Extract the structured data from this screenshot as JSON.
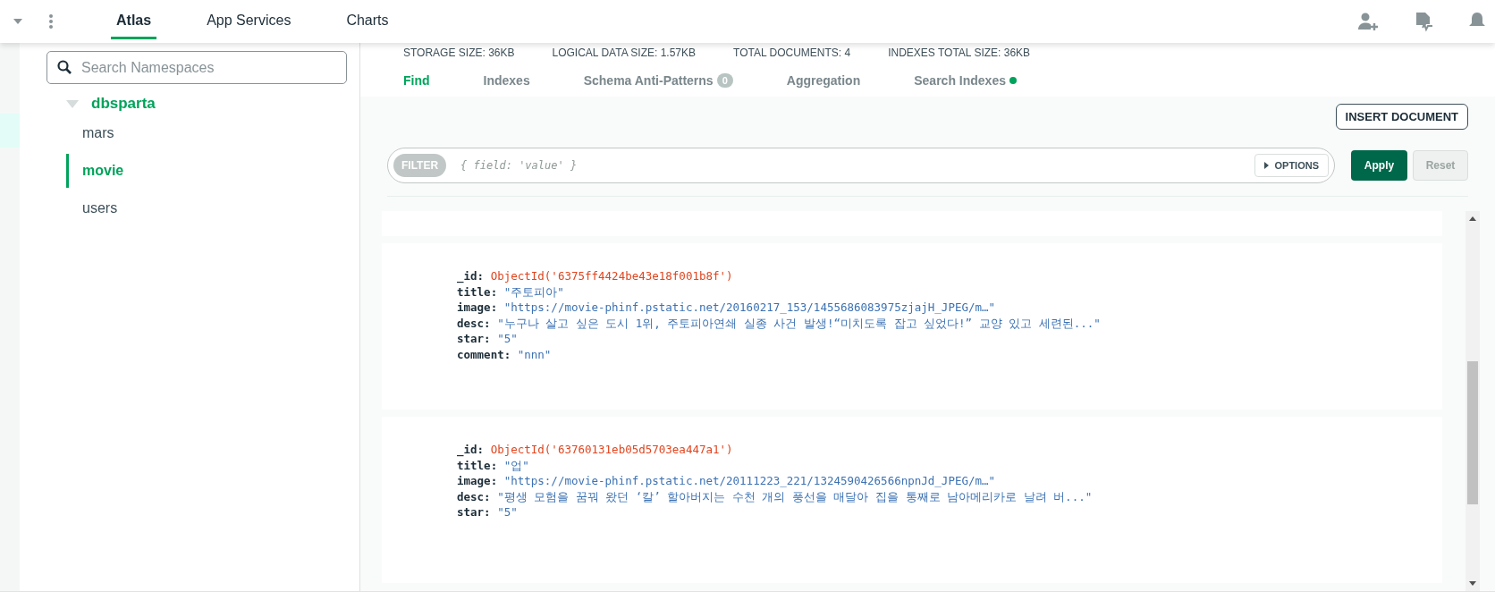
{
  "header": {
    "tabs": [
      {
        "label": "Atlas",
        "selected": true
      },
      {
        "label": "App Services",
        "selected": false
      },
      {
        "label": "Charts",
        "selected": false
      }
    ]
  },
  "sidebar": {
    "search": {
      "placeholder": "Search Namespaces"
    },
    "database": {
      "name": "dbsparta",
      "expanded": true,
      "collections": [
        {
          "name": "mars",
          "selected": false
        },
        {
          "name": "movie",
          "selected": true
        },
        {
          "name": "users",
          "selected": false
        }
      ]
    }
  },
  "stats": [
    "STORAGE SIZE: 36KB",
    "LOGICAL DATA SIZE: 1.57KB",
    "TOTAL DOCUMENTS: 4",
    "INDEXES TOTAL SIZE: 36KB"
  ],
  "tabs": [
    {
      "label": "Find",
      "selected": true
    },
    {
      "label": "Indexes",
      "selected": false
    },
    {
      "label": "Schema Anti-Patterns",
      "selected": false,
      "badge": "0"
    },
    {
      "label": "Aggregation",
      "selected": false
    },
    {
      "label": "Search Indexes",
      "selected": false,
      "indicator": true
    }
  ],
  "toolbar": {
    "insert_button": "INSERT DOCUMENT",
    "filter": {
      "label": "FILTER",
      "placeholder": "{ field: 'value' }",
      "options": "OPTIONS"
    },
    "apply": "Apply",
    "reset": {
      "label": "Reset",
      "disabled": true
    }
  },
  "documents": [
    {
      "kind": "collapsed"
    },
    {
      "kind": "document",
      "fields": [
        {
          "key": "_id:",
          "value": "ObjectId('6375ff4424be43e18f001b8f')",
          "kind": "objectid"
        },
        {
          "key": "title:",
          "value": "\"주토피아\"",
          "kind": "string"
        },
        {
          "key": "image:",
          "value": "\"https://movie-phinf.pstatic.net/20160217_153/1455686083975zjajH_JPEG/m…\"",
          "kind": "string"
        },
        {
          "key": "desc:",
          "value": "\"누구나 살고 싶은 도시 1위, 주토피아연쇄 실종 사건 발생!“미치도록 잡고 싶었다!” 교양 있고 세련된...\"",
          "kind": "string"
        },
        {
          "key": "star:",
          "value": "\"5\"",
          "kind": "string"
        },
        {
          "key": "comment:",
          "value": "\"nnn\"",
          "kind": "string"
        }
      ]
    },
    {
      "kind": "document",
      "fields": [
        {
          "key": "_id:",
          "value": "ObjectId('63760131eb05d5703ea447a1')",
          "kind": "objectid"
        },
        {
          "key": "title:",
          "value": "\"업\"",
          "kind": "string"
        },
        {
          "key": "image:",
          "value": "\"https://movie-phinf.pstatic.net/20111223_221/1324590426566npnJd_JPEG/m…\"",
          "kind": "string"
        },
        {
          "key": "desc:",
          "value": "\"평생 모험을 꿈꿔 왔던 ‘칼’ 할아버지는 수천 개의 풍선을 매달아 집을 통째로 남아메리카로 날려 버...\"",
          "kind": "string"
        },
        {
          "key": "star:",
          "value": "\"5\"",
          "kind": "string"
        }
      ]
    }
  ]
}
